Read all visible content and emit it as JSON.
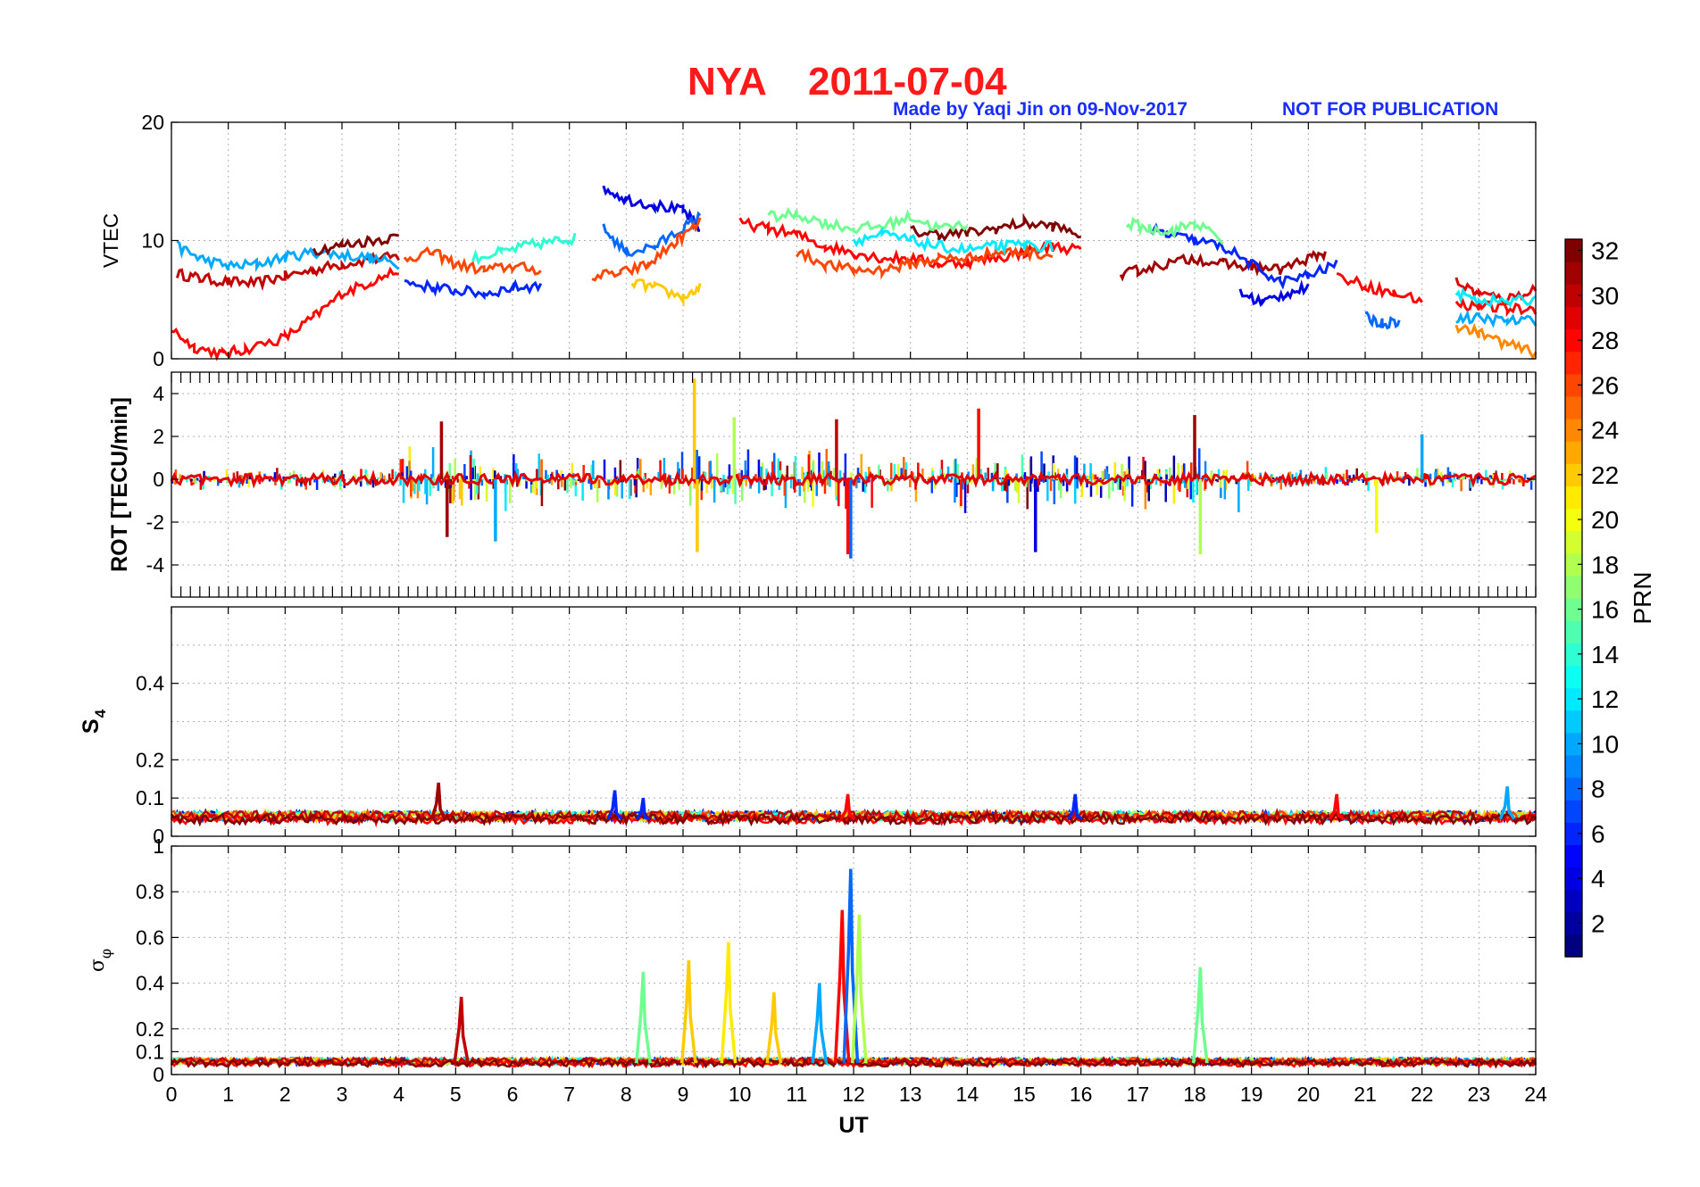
{
  "chart_data": {
    "title_station": "NYA",
    "title_date": "2011-07-04",
    "credit": "Made by Yaqi Jin on 09-Nov-2017",
    "notice": "NOT FOR PUBLICATION",
    "title_color": "#ff1a1a",
    "credit_color": "#1a2dff",
    "xlabel": "UT",
    "xlim": [
      0,
      24
    ],
    "xticks": [
      "0",
      "1",
      "2",
      "3",
      "4",
      "5",
      "6",
      "7",
      "8",
      "9",
      "10",
      "11",
      "12",
      "13",
      "14",
      "15",
      "16",
      "17",
      "18",
      "19",
      "20",
      "21",
      "22",
      "23",
      "24"
    ],
    "panels": [
      {
        "type": "line",
        "ylabel": "VTEC",
        "ylim": [
          0,
          20
        ],
        "yticks": [
          "0",
          "10",
          "20"
        ],
        "representative_series": [
          {
            "prn": 30,
            "x": [
              0.1,
              0.5,
              1,
              1.5,
              2,
              2.5,
              3,
              3.5,
              4
            ],
            "y": [
              7.2,
              6.8,
              6.5,
              6.4,
              7,
              7.5,
              8,
              8.4,
              8.6
            ]
          },
          {
            "prn": 28,
            "x": [
              0.0,
              0.4,
              0.9,
              1.3,
              2,
              2.5,
              3,
              3.5,
              4
            ],
            "y": [
              2.5,
              1,
              0.4,
              0.8,
              1.8,
              3.5,
              5.5,
              6.5,
              7.5
            ]
          },
          {
            "prn": 10,
            "x": [
              0.1,
              0.5,
              1,
              1.5,
              2,
              2.5,
              3,
              3.5,
              4
            ],
            "y": [
              9.5,
              8.5,
              7.8,
              8,
              8.6,
              9,
              8.8,
              8.5,
              8
            ]
          },
          {
            "prn": 32,
            "x": [
              2.5,
              3,
              3.5,
              4
            ],
            "y": [
              9.2,
              9.6,
              10,
              10.3
            ]
          },
          {
            "prn": 26,
            "x": [
              4.1,
              4.6,
              5,
              5.5,
              6,
              6.5
            ],
            "y": [
              8.5,
              9,
              8,
              7.5,
              7.8,
              7.5
            ]
          },
          {
            "prn": 6,
            "x": [
              4.1,
              4.6,
              5,
              5.5,
              6,
              6.5
            ],
            "y": [
              6.5,
              6,
              5.8,
              5.5,
              6,
              6.2
            ]
          },
          {
            "prn": 14,
            "x": [
              5.3,
              5.8,
              6.3,
              6.8,
              7.1
            ],
            "y": [
              8.5,
              9,
              9.6,
              10,
              10.2
            ]
          },
          {
            "prn": 4,
            "x": [
              7.6,
              8,
              8.5,
              9,
              9.3
            ],
            "y": [
              14.5,
              13.5,
              13,
              12.5,
              11
            ]
          },
          {
            "prn": 8,
            "x": [
              7.6,
              8,
              8.5,
              9,
              9.3
            ],
            "y": [
              11,
              9,
              9.5,
              11,
              12
            ]
          },
          {
            "prn": 26,
            "x": [
              7.4,
              7.9,
              8.4,
              8.9,
              9.3
            ],
            "y": [
              7,
              7.2,
              8,
              10,
              11.5
            ]
          },
          {
            "prn": 22,
            "x": [
              8.1,
              8.5,
              9,
              9.3
            ],
            "y": [
              6.5,
              6,
              5.2,
              6
            ]
          },
          {
            "prn": 28,
            "x": [
              10,
              10.5,
              11,
              11.5,
              12,
              12.5,
              13,
              13.5,
              14,
              14.5,
              15,
              15.5,
              16
            ],
            "y": [
              11.5,
              11,
              10.5,
              9.5,
              9,
              8.5,
              8.5,
              8,
              8.2,
              8.5,
              9,
              9.5,
              9.2
            ]
          },
          {
            "prn": 32,
            "x": [
              13,
              13.5,
              14,
              14.5,
              15,
              15.5,
              16
            ],
            "y": [
              10.8,
              10.5,
              10.6,
              11,
              11.5,
              11.2,
              10.5
            ]
          },
          {
            "prn": 16,
            "x": [
              10.5,
              11,
              11.5,
              12,
              12.5,
              13,
              13.5,
              14
            ],
            "y": [
              12,
              12.2,
              11.5,
              11,
              11.2,
              12,
              11,
              11.4
            ]
          },
          {
            "prn": 26,
            "x": [
              11,
              11.5,
              12,
              12.5,
              13,
              13.5,
              14,
              14.5,
              15,
              15.5
            ],
            "y": [
              9,
              8,
              7.5,
              7.5,
              8,
              8.5,
              8.5,
              9,
              9,
              8.8
            ]
          },
          {
            "prn": 12,
            "x": [
              12,
              12.5,
              13,
              13.5,
              14,
              14.5,
              15,
              15.5
            ],
            "y": [
              10,
              10.5,
              10,
              9.5,
              9.2,
              9.5,
              9.6,
              9.5
            ]
          },
          {
            "prn": 31,
            "x": [
              16.7,
              17,
              17.5,
              18,
              18.5,
              19,
              19.5,
              20,
              20.3
            ],
            "y": [
              7,
              7.5,
              8,
              8.5,
              8,
              7.8,
              7.5,
              8.5,
              9
            ]
          },
          {
            "prn": 6,
            "x": [
              17.2,
              17.5,
              18,
              18.5,
              19,
              19.5,
              20,
              20.5
            ],
            "y": [
              11,
              10.5,
              10,
              9.5,
              8,
              6.5,
              7,
              8
            ]
          },
          {
            "prn": 16,
            "x": [
              16.8,
              17.2,
              17.6,
              18,
              18.5
            ],
            "y": [
              11.5,
              11,
              10.8,
              11.5,
              10
            ]
          },
          {
            "prn": 4,
            "x": [
              18.8,
              19.2,
              19.6,
              20
            ],
            "y": [
              5.5,
              4.8,
              5.5,
              6
            ]
          },
          {
            "prn": 8,
            "x": [
              21,
              21.3,
              21.6
            ],
            "y": [
              3.5,
              3,
              3.2
            ]
          },
          {
            "prn": 28,
            "x": [
              20.5,
              21,
              21.5,
              22
            ],
            "y": [
              7,
              6.2,
              5.5,
              5
            ]
          },
          {
            "prn": 29,
            "x": [
              22.6,
              23,
              23.5,
              24
            ],
            "y": [
              6.5,
              5.5,
              5,
              6
            ]
          },
          {
            "prn": 28,
            "x": [
              22.6,
              23,
              23.5,
              24
            ],
            "y": [
              4.6,
              4.5,
              4.2,
              4.2
            ]
          },
          {
            "prn": 24,
            "x": [
              22.6,
              23,
              23.5,
              24
            ],
            "y": [
              2.8,
              2.2,
              1.2,
              0.5
            ]
          },
          {
            "prn": 12,
            "x": [
              22.6,
              23,
              23.5,
              24
            ],
            "y": [
              5.5,
              5,
              4.8,
              5
            ]
          },
          {
            "prn": 10,
            "x": [
              22.6,
              23,
              23.5,
              24
            ],
            "y": [
              3.5,
              3.4,
              3.2,
              3.2
            ]
          }
        ]
      },
      {
        "type": "line",
        "ylabel": "ROT [TECU/min]",
        "ylim": [
          -5.5,
          5
        ],
        "yticks": [
          "-4",
          "-2",
          "0",
          "2",
          "4"
        ],
        "representative_spikes": [
          {
            "prn": 31,
            "x": 4.75,
            "y": 2.7
          },
          {
            "prn": 31,
            "x": 4.85,
            "y": -2.7
          },
          {
            "prn": 10,
            "x": 5.7,
            "y": -2.9
          },
          {
            "prn": 22,
            "x": 9.2,
            "y": 4.7
          },
          {
            "prn": 22,
            "x": 9.25,
            "y": -3.4
          },
          {
            "prn": 18,
            "x": 9.9,
            "y": 2.9
          },
          {
            "prn": 28,
            "x": 11.9,
            "y": -3.5
          },
          {
            "prn": 8,
            "x": 11.95,
            "y": -3.7
          },
          {
            "prn": 30,
            "x": 11.7,
            "y": 2.8
          },
          {
            "prn": 28,
            "x": 14.2,
            "y": 3.3
          },
          {
            "prn": 4,
            "x": 15.2,
            "y": -3.4
          },
          {
            "prn": 31,
            "x": 18.0,
            "y": 3.0
          },
          {
            "prn": 18,
            "x": 18.1,
            "y": -3.5
          },
          {
            "prn": 10,
            "x": 22.0,
            "y": 2.1
          },
          {
            "prn": 20,
            "x": 21.2,
            "y": -2.5
          }
        ]
      },
      {
        "type": "line",
        "ylabel": "S4",
        "ylim": [
          0,
          0.6
        ],
        "yticks": [
          "0",
          "0.1",
          "0.2",
          "0.4"
        ],
        "representative_peaks": [
          {
            "prn": 31,
            "x": 4.7,
            "y": 0.14
          },
          {
            "prn": 6,
            "x": 7.8,
            "y": 0.12
          },
          {
            "prn": 6,
            "x": 8.3,
            "y": 0.1
          },
          {
            "prn": 28,
            "x": 11.9,
            "y": 0.11
          },
          {
            "prn": 6,
            "x": 15.9,
            "y": 0.11
          },
          {
            "prn": 28,
            "x": 20.5,
            "y": 0.11
          },
          {
            "prn": 10,
            "x": 23.5,
            "y": 0.13
          }
        ]
      },
      {
        "type": "line",
        "ylabel": "σφ",
        "ylim": [
          0,
          1.0
        ],
        "yticks": [
          "0",
          "0.1",
          "0.2",
          "0.4",
          "0.6",
          "0.8",
          "1"
        ],
        "representative_peaks": [
          {
            "prn": 30,
            "x": 5.1,
            "y": 0.34
          },
          {
            "prn": 16,
            "x": 8.3,
            "y": 0.45
          },
          {
            "prn": 22,
            "x": 9.1,
            "y": 0.5
          },
          {
            "prn": 21,
            "x": 9.8,
            "y": 0.58
          },
          {
            "prn": 22,
            "x": 10.6,
            "y": 0.36
          },
          {
            "prn": 10,
            "x": 11.4,
            "y": 0.4
          },
          {
            "prn": 28,
            "x": 11.8,
            "y": 0.72
          },
          {
            "prn": 8,
            "x": 11.95,
            "y": 0.9
          },
          {
            "prn": 18,
            "x": 12.1,
            "y": 0.7
          },
          {
            "prn": 16,
            "x": 18.1,
            "y": 0.47
          }
        ]
      }
    ],
    "colorbar": {
      "label": "PRN",
      "range": [
        1,
        32
      ],
      "ticks": [
        "2",
        "4",
        "6",
        "8",
        "10",
        "12",
        "14",
        "16",
        "18",
        "20",
        "22",
        "24",
        "26",
        "28",
        "30",
        "32"
      ],
      "colormap": "jet"
    }
  }
}
